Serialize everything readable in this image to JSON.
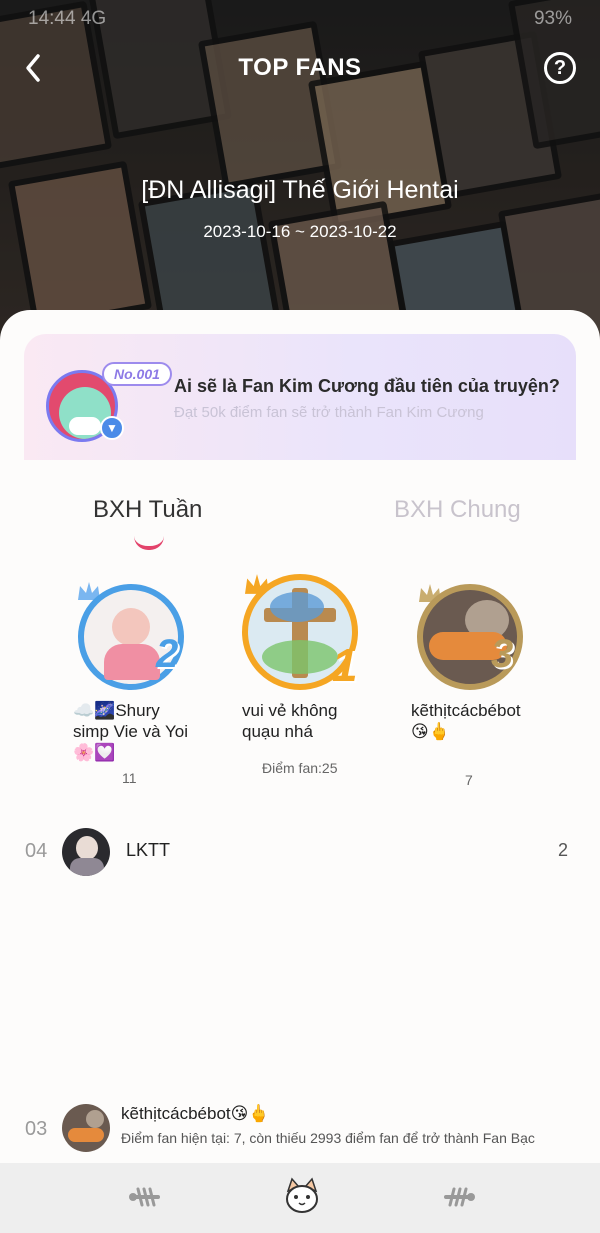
{
  "status_bar": {
    "time": "14:44",
    "network": "4G",
    "battery": "93%"
  },
  "header": {
    "title": "TOP FANS",
    "story_title": "[ĐN Allisagi] Thế Giới Hentai",
    "date_range": "2023-10-16 ~ 2023-10-22"
  },
  "banner": {
    "badge": "No.001",
    "headline": "Ai sẽ là Fan Kim Cương đầu tiên của truyện?",
    "subtext": "Đạt 50k điểm fan sẽ trở thành Fan Kim Cương"
  },
  "tabs": [
    {
      "label": "BXH Tuần",
      "active": true
    },
    {
      "label": "BXH Chung",
      "active": false
    }
  ],
  "podium": [
    {
      "rank": "2",
      "name": "☁️🌌Shury simp Vie và Yoi🌸💟",
      "score": "11"
    },
    {
      "rank": "1",
      "name": "vui vẻ không quạu nhá",
      "score": "Điểm fan:25"
    },
    {
      "rank": "3",
      "name": "kẽthịtcácbébot😘🖕",
      "score": "7"
    }
  ],
  "list": [
    {
      "rank": "04",
      "name": "LKTT",
      "score": "2"
    }
  ],
  "me": {
    "rank": "03",
    "name": "kẽthịtcácbébot😘🖕",
    "description": "Điểm fan hiện tại: 7, còn thiếu 2993 điểm fan để trở thành Fan Bạc"
  },
  "colors": {
    "accent": "#e3436b",
    "gold": "#f5a623",
    "silver": "#4a9fe6",
    "bronze": "#b99a5a"
  },
  "icons": [
    "back-arrow-icon",
    "help-icon",
    "fishbone-icon",
    "cat-face-icon"
  ]
}
